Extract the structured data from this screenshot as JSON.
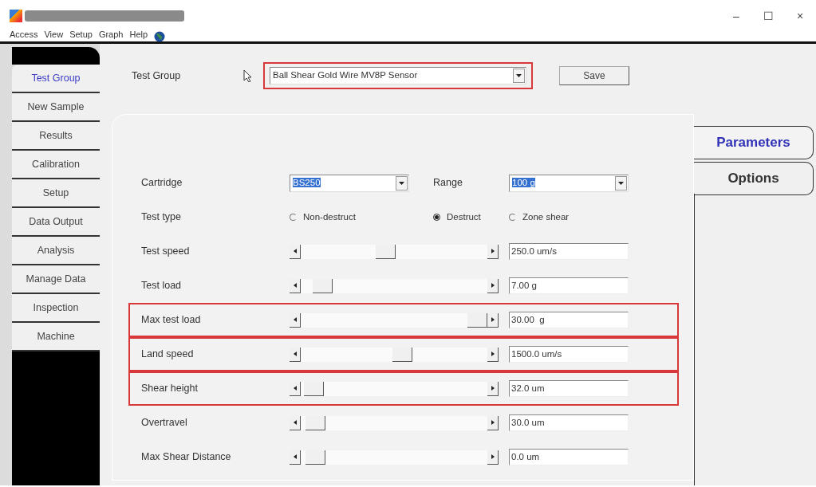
{
  "window": {
    "controls": [
      "–",
      "☐",
      "×"
    ]
  },
  "menu": [
    "Access",
    "View",
    "Setup",
    "Graph",
    "Help"
  ],
  "sidebar": {
    "items": [
      {
        "label": "Test Group",
        "selected": true
      },
      {
        "label": "New Sample",
        "selected": false
      },
      {
        "label": "Results",
        "selected": false
      },
      {
        "label": "Calibration",
        "selected": false
      },
      {
        "label": "Setup",
        "selected": false
      },
      {
        "label": "Data Output",
        "selected": false
      },
      {
        "label": "Analysis",
        "selected": false
      },
      {
        "label": "Manage Data",
        "selected": false
      },
      {
        "label": "Inspection",
        "selected": false
      },
      {
        "label": "Machine",
        "selected": false
      }
    ]
  },
  "test_group": {
    "label": "Test Group",
    "value": "Ball Shear Gold Wire MV8P Sensor",
    "highlighted": true
  },
  "save_button": "Save",
  "tabs": [
    {
      "label": "Parameters",
      "selected": true
    },
    {
      "label": "Options",
      "selected": false
    }
  ],
  "rows": [
    {
      "kind": "combo",
      "label": "Cartridge",
      "value": "BS250",
      "label2": "Range",
      "value2": "100 g",
      "highlighted": false
    },
    {
      "kind": "radio",
      "label": "Test type",
      "options": [
        {
          "label": "Non-destruct",
          "selected": false
        },
        {
          "label": "Destruct",
          "selected": true
        },
        {
          "label": "Zone shear",
          "selected": false
        }
      ],
      "highlighted": false
    },
    {
      "kind": "slider",
      "label": "Test speed",
      "level": 0.45,
      "value": "250.0 um/s",
      "highlighted": false
    },
    {
      "kind": "slider",
      "label": "Test load",
      "level": 0.07,
      "value": "7.00 g",
      "highlighted": false
    },
    {
      "kind": "slider",
      "label": "Max test load",
      "level": 1,
      "value": "30.00  g",
      "highlighted": true
    },
    {
      "kind": "slider",
      "label": "Land speed",
      "level": 0.55,
      "value": "1500.0 um/s",
      "highlighted": true
    },
    {
      "kind": "slider",
      "label": "Shear height",
      "level": 0.02,
      "value": "32.0 um",
      "highlighted": true
    },
    {
      "kind": "slider",
      "label": "Overtravel",
      "level": 0.03,
      "value": "30.0 um",
      "highlighted": false
    },
    {
      "kind": "slider",
      "label": "Max Shear Distance",
      "level": 0.03,
      "value": "0.0 um",
      "highlighted": false
    }
  ]
}
